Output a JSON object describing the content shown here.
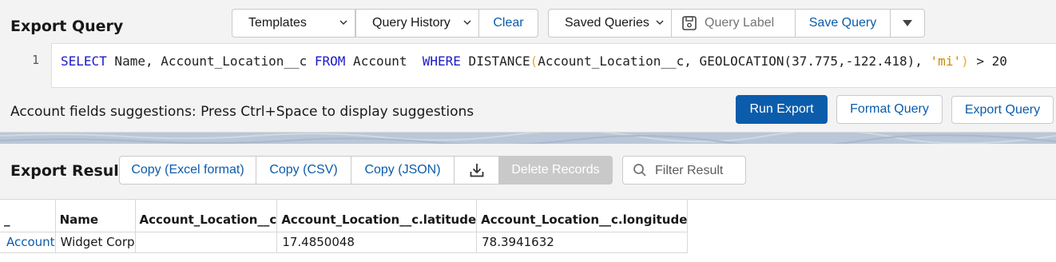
{
  "query_panel": {
    "title": "Export Query",
    "templates_label": "Templates",
    "query_history_label": "Query History",
    "clear_label": "Clear",
    "saved_queries_label": "Saved Queries",
    "query_label_placeholder": "Query Label",
    "save_query_label": "Save Query",
    "editor": {
      "line_number": "1",
      "query": "SELECT Name, Account_Location__c FROM Account  WHERE DISTANCE(Account_Location__c, GEOLOCATION(37.775,-122.418), 'mi') > 20",
      "tokens": {
        "select": "SELECT",
        "fields": " Name, Account_Location__c ",
        "from": "FROM",
        "object": " Account  ",
        "where": "WHERE",
        "distance_fn": " DISTANCE",
        "open_paren": "(",
        "distance_args_1": "Account_Location__c, GEOLOCATION(37.775,-122.418), ",
        "unit": "'mi'",
        "close_paren": ")",
        "tail": " > 20"
      }
    },
    "hint": "Account fields suggestions: Press Ctrl+Space to display suggestions",
    "run_export_label": "Run Export",
    "format_query_label": "Format Query",
    "export_query_label": "Export Query"
  },
  "result_panel": {
    "title": "Export Result",
    "copy_excel_label": "Copy (Excel format)",
    "copy_csv_label": "Copy (CSV)",
    "copy_json_label": "Copy (JSON)",
    "download_icon": "download-icon",
    "delete_records_label": "Delete Records",
    "filter_placeholder": "Filter Result"
  },
  "table": {
    "headers": [
      "_",
      "Name",
      "Account_Location__c",
      "Account_Location__c.latitude",
      "Account_Location__c.longitude"
    ],
    "rows": [
      [
        "Account",
        "Widget Corp",
        "",
        "17.4850048",
        "78.3941632"
      ]
    ]
  },
  "colors": {
    "accent": "#0b5cab",
    "keyword": "#1a1ac8",
    "string": "#c88a00",
    "paren": "#f0a830",
    "disabled": "#c9c9c9"
  }
}
